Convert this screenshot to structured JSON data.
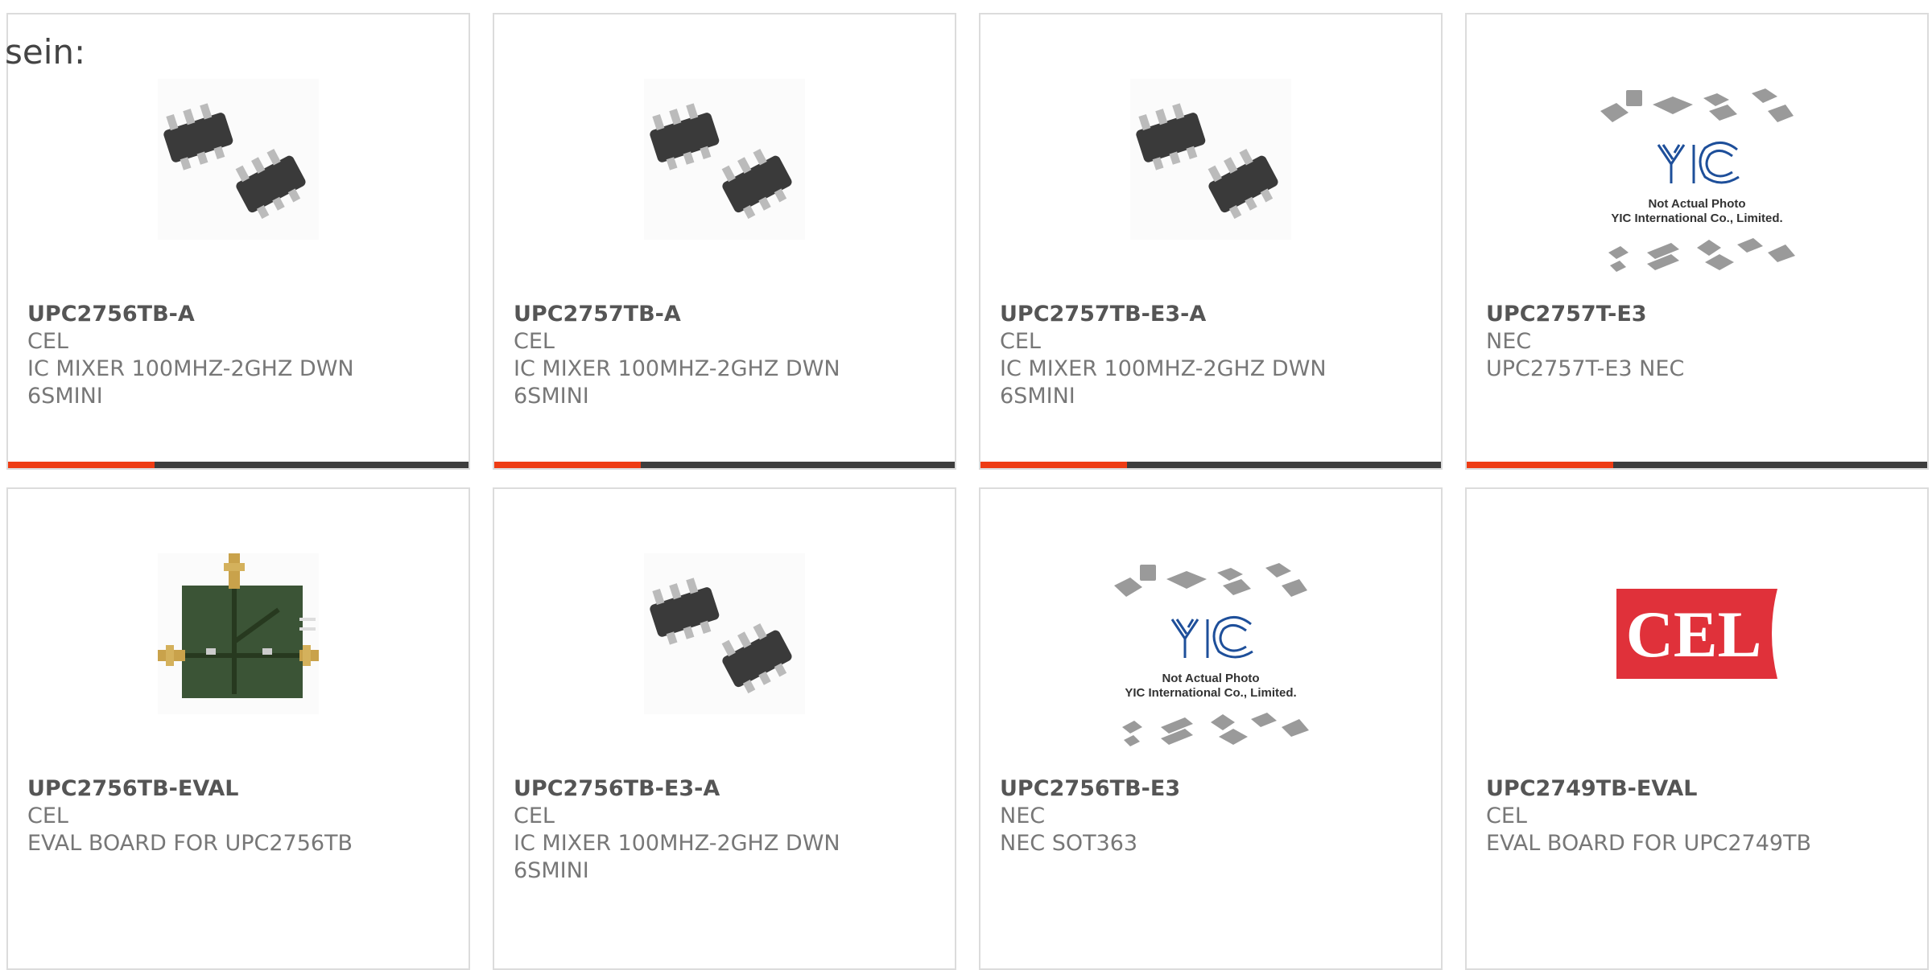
{
  "lead_text": "sein:",
  "products": [
    {
      "part": "UPC2756TB-A",
      "maker": "CEL",
      "desc": [
        "IC MIXER 100MHZ-2GHZ DWN",
        "6SMINI"
      ],
      "image": "sot363-chip-photo",
      "show_bar": true
    },
    {
      "part": "UPC2757TB-A",
      "maker": "CEL",
      "desc": [
        "IC MIXER 100MHZ-2GHZ DWN",
        "6SMINI"
      ],
      "image": "sot363-chip-photo",
      "show_bar": true
    },
    {
      "part": "UPC2757TB-E3-A",
      "maker": "CEL",
      "desc": [
        "IC MIXER 100MHZ-2GHZ DWN",
        "6SMINI"
      ],
      "image": "sot363-chip-photo",
      "show_bar": true
    },
    {
      "part": "UPC2757T-E3",
      "maker": "NEC",
      "desc": [
        "UPC2757T-E3 NEC",
        ""
      ],
      "image": "yic-placeholder",
      "placeholder_lines": [
        "Not Actual Photo",
        "YIC International Co., Limited."
      ],
      "show_bar": true
    },
    {
      "part": "UPC2756TB-EVAL",
      "maker": "CEL",
      "desc": [
        "EVAL BOARD FOR UPC2756TB",
        ""
      ],
      "image": "eval-board-photo",
      "show_bar": false
    },
    {
      "part": "UPC2756TB-E3-A",
      "maker": "CEL",
      "desc": [
        "IC MIXER 100MHZ-2GHZ DWN",
        "6SMINI"
      ],
      "image": "sot363-chip-photo",
      "show_bar": false
    },
    {
      "part": "UPC2756TB-E3",
      "maker": "NEC",
      "desc": [
        "NEC SOT363",
        ""
      ],
      "image": "yic-placeholder",
      "placeholder_lines": [
        "Not Actual Photo",
        "YIC International Co., Limited."
      ],
      "show_bar": false
    },
    {
      "part": "UPC2749TB-EVAL",
      "maker": "CEL",
      "desc": [
        "EVAL BOARD FOR UPC2749TB",
        ""
      ],
      "image": "cel-logo",
      "logo_text": "CEL",
      "show_bar": false
    }
  ],
  "colors": {
    "accent": "#ee3c14",
    "bar": "#3d3d3d",
    "border": "#dcdcdc",
    "cel_red": "#e0313a"
  }
}
